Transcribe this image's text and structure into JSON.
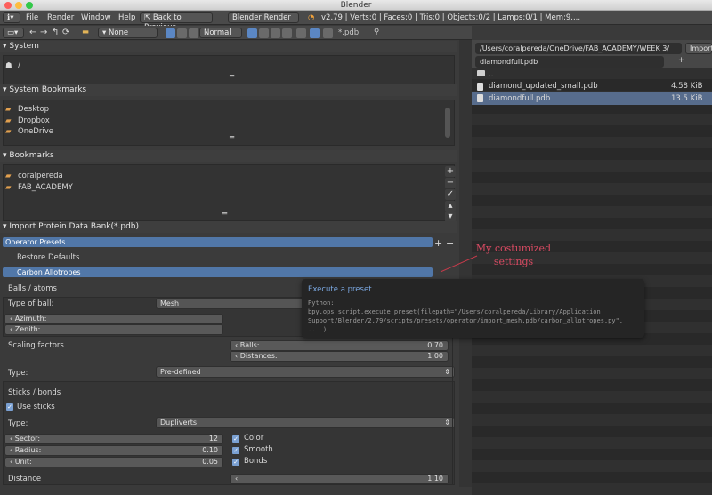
{
  "window_title": "Blender",
  "menu": {
    "file": "File",
    "render": "Render",
    "window": "Window",
    "help": "Help",
    "back": "Back to Previous",
    "engine": "Blender Render",
    "stats": "v2.79 | Verts:0 | Faces:0 | Tris:0 | Objects:0/2 | Lamps:0/1 | Mem:9...."
  },
  "toolbar": {
    "none": "None",
    "normal": "Normal",
    "filter": "*.pdb"
  },
  "filebrowser": {
    "path": "/Users/coralpereda/OneDrive/FAB_ACADEMY/WEEK 3/",
    "import_label": "Import",
    "filename": "diamondfull.pdb",
    "minus": "−",
    "plus": "+",
    "up": "..",
    "files": [
      {
        "name": "diamond_updated_small.pdb",
        "size": "4.58 KiB"
      },
      {
        "name": "diamondfull.pdb",
        "size": "13.5 KiB"
      }
    ]
  },
  "system": {
    "title": "System",
    "root": "/"
  },
  "sysbookmarks": {
    "title": "System Bookmarks",
    "items": [
      "Desktop",
      "Dropbox",
      "OneDrive"
    ]
  },
  "bookmarks": {
    "title": "Bookmarks",
    "items": [
      "coralpereda",
      "FAB_ACADEMY"
    ]
  },
  "import": {
    "title": "Import Protein Data Bank(*.pdb)",
    "operator_presets": "Operator Presets",
    "restore": "Restore Defaults",
    "carbon": "Carbon Allotropes"
  },
  "annotation": {
    "line1": "My costumized",
    "line2": "settings"
  },
  "tooltip": {
    "title": "Execute a preset",
    "l1": "Python:",
    "l2": "bpy.ops.script.execute_preset(filepath=\"/Users/coralpereda/Library/Application",
    "l3": "Support/Blender/2.79/scripts/presets/operator/import_mesh.pdb/carbon_allotropes.py\",",
    "l4": "... )"
  },
  "balls": {
    "section": "Balls / atoms",
    "type_label": "Type of ball:",
    "type_value": "Mesh",
    "azimuth": "Azimuth:",
    "zenith": "Zenith:",
    "scaling": "Scaling factors",
    "balls_label": "Balls:",
    "balls_value": "0.70",
    "dist_label": "Distances:",
    "dist_value": "1.00",
    "type2_label": "Type:",
    "type2_value": "Pre-defined"
  },
  "sticks": {
    "section": "Sticks / bonds",
    "use_sticks": "Use sticks",
    "type_label": "Type:",
    "type_value": "Dupliverts",
    "sector": "Sector:",
    "sector_value": "12",
    "radius": "Radius:",
    "radius_value": "0.10",
    "unit": "Unit:",
    "unit_value": "0.05",
    "color": "Color",
    "smooth": "Smooth",
    "bonds": "Bonds",
    "distance": "Distance",
    "distance_value": "1.10"
  }
}
